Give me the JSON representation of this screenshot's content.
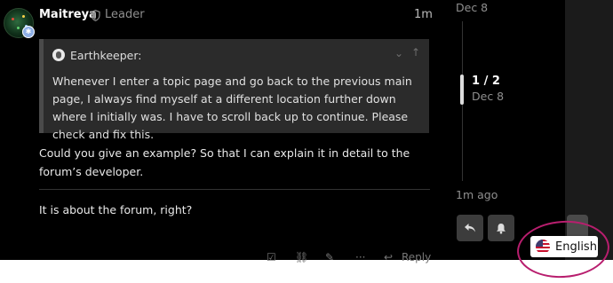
{
  "post": {
    "username": "Maitreya",
    "role": "Leader",
    "time": "1m",
    "quote": {
      "author": "Earthkeeper:",
      "text": "Whenever I enter a topic page and go back to the previous main page, I always find myself at a different location further down where I initially was. I have to scroll back up to continue. Please check and fix this."
    },
    "body": "Could you give an example? So that I can explain it in detail to the forum’s developer.",
    "reply_preview": "It is about the forum, right?",
    "actions": {
      "reply_label": "Reply"
    }
  },
  "timeline": {
    "top_date": "Dec 8",
    "position": "1 / 2",
    "position_date": "Dec 8",
    "last_activity": "1m ago"
  },
  "language": {
    "label": "English"
  },
  "colors": {
    "annotation": "#b81e6e",
    "background": "#000000",
    "quote_bg": "#2b2b2b"
  }
}
